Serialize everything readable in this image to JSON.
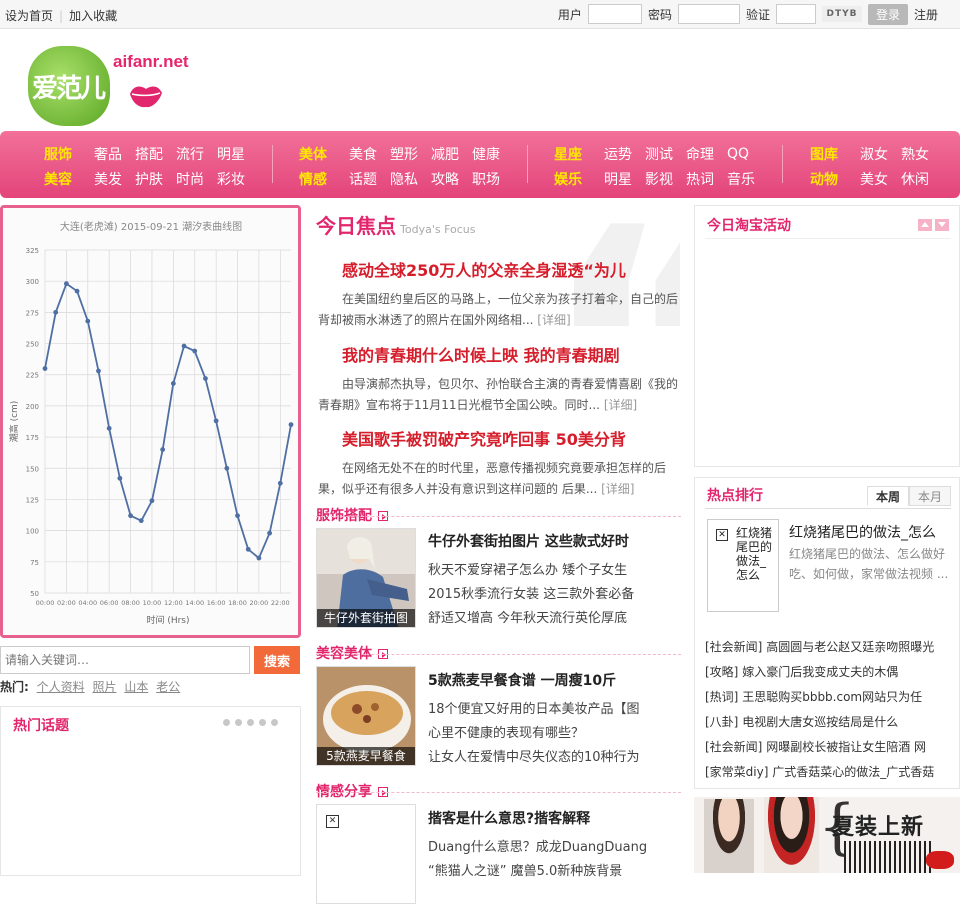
{
  "topbar": {
    "set_home": "设为首页",
    "bookmark": "加入收藏",
    "user_label": "用户",
    "password_label": "密码",
    "captcha_label": "验证",
    "captcha_text": "DTYB",
    "login_button": "登录",
    "register": "注册"
  },
  "logo": {
    "text": "爱范儿",
    "url": "aifanr.net"
  },
  "nav": {
    "groups": [
      {
        "heads": [
          "服饰",
          "美容"
        ],
        "rows": [
          [
            "奢品",
            "搭配",
            "流行",
            "明星"
          ],
          [
            "美发",
            "护肤",
            "时尚",
            "彩妆"
          ]
        ]
      },
      {
        "heads": [
          "美体",
          "情感"
        ],
        "rows": [
          [
            "美食",
            "塑形",
            "减肥",
            "健康"
          ],
          [
            "话题",
            "隐私",
            "攻略",
            "职场"
          ]
        ]
      },
      {
        "heads": [
          "星座",
          "娱乐"
        ],
        "rows": [
          [
            "运势",
            "测试",
            "命理",
            "QQ"
          ],
          [
            "明星",
            "影视",
            "热词",
            "音乐"
          ]
        ]
      },
      {
        "heads": [
          "图库",
          "动物"
        ],
        "rows": [
          [
            "淑女",
            "熟女"
          ],
          [
            "美女",
            "休闲"
          ]
        ]
      }
    ]
  },
  "chart_data": {
    "type": "line",
    "title": "大连(老虎滩) 2015-09-21 潮汐表曲线图",
    "xlabel": "时间 (Hrs)",
    "ylabel": "潮高 (cm)",
    "x": [
      "00:00",
      "01:00",
      "02:00",
      "03:00",
      "04:00",
      "05:00",
      "06:00",
      "07:00",
      "08:00",
      "09:00",
      "10:00",
      "11:00",
      "12:00",
      "13:00",
      "14:00",
      "15:00",
      "16:00",
      "17:00",
      "18:00",
      "19:00",
      "20:00",
      "21:00",
      "22:00",
      "23:00"
    ],
    "x_ticks": [
      "00:00",
      "02:00",
      "04:00",
      "06:00",
      "08:00",
      "10:00",
      "12:00",
      "14:00",
      "16:00",
      "18:00",
      "20:00",
      "22:00"
    ],
    "y": [
      230,
      275,
      298,
      292,
      268,
      228,
      182,
      142,
      112,
      108,
      124,
      165,
      218,
      248,
      244,
      222,
      188,
      150,
      112,
      85,
      78,
      98,
      138,
      185
    ],
    "ylim": [
      50,
      325
    ],
    "y_ticks": [
      50,
      75,
      100,
      125,
      150,
      175,
      200,
      225,
      250,
      275,
      300,
      325
    ],
    "grid": true,
    "color": "#4f6fa3"
  },
  "search": {
    "placeholder": "请输入关键词…",
    "button": "搜索",
    "hot_label": "热门:",
    "hot_tags": [
      "个人资料",
      "照片",
      "山本",
      "老公"
    ]
  },
  "topics": {
    "title": "热门话题"
  },
  "focus": {
    "title": "今日焦点",
    "subtitle": "Todya's Focus",
    "items": [
      {
        "title": "感动全球250万人的父亲全身湿透“为儿",
        "desc": "在美国纽约皇后区的马路上，一位父亲为孩子打着伞，自己的后背却被雨水淋透了的照片在国外网络相...",
        "more": "[详细]"
      },
      {
        "title": "我的青春期什么时候上映  我的青春期剧",
        "desc": "由导演郝杰执导，包贝尔、孙怡联合主演的青春爱情喜剧《我的青春期》宣布将于11月11日光棍节全国公映。同时...",
        "more": "[详细]"
      },
      {
        "title": "美国歌手被罚破产究竟咋回事  50美分背",
        "desc": "在网络无处不在的时代里，恶意传播视频究竟要承担怎样的后果，似乎还有很多人并没有意识到这样问题的 后果...",
        "more": "[详细]"
      }
    ]
  },
  "sections": [
    {
      "title": "服饰搭配",
      "thumb_caption": "牛仔外套街拍图",
      "headline": "牛仔外套街拍图片  这些款式好时",
      "items": [
        "秋天不爱穿裙子怎么办  矮个子女生",
        "2015秋季流行女装  这三款外套必备",
        "舒适又增高  今年秋天流行英伦厚底"
      ]
    },
    {
      "title": "美容美体",
      "thumb_caption": "5款燕麦早餐食",
      "headline": "5款燕麦早餐食谱  一周瘦10斤",
      "items": [
        "18个便宜又好用的日本美妆产品【图",
        "心里不健康的表现有哪些？",
        "让女人在爱情中尽失仪态的10种行为"
      ]
    },
    {
      "title": "情感分享",
      "thumb_caption": "",
      "headline": "揩客是什么意思?揩客解释",
      "items": [
        "Duang什么意思？成龙DuangDuang",
        "“熊猫人之谜” 魔兽5.0新种族背景"
      ]
    }
  ],
  "taobao": {
    "title": "今日淘宝活动"
  },
  "ranking": {
    "title": "热点排行",
    "tab_week": "本周",
    "tab_month": "本月",
    "feature_img_alt": "红烧猪尾巴的做法_怎么",
    "feature_title": "红烧猪尾巴的做法_怎么",
    "feature_desc": "红烧猪尾巴的做法、怎么做好吃、如何做，家常做法视频 ...",
    "list": [
      {
        "tag": "[社会新闻]",
        "text": "高圆圆与老公赵又廷亲吻照曝光"
      },
      {
        "tag": "[攻略]",
        "text": "嫁入豪门后我变成丈夫的木偶"
      },
      {
        "tag": "[热词]",
        "text": "王思聪购买bbbb.com网站只为任"
      },
      {
        "tag": "[八卦]",
        "text": "电视剧大唐女巡按结局是什么"
      },
      {
        "tag": "[社会新闻]",
        "text": "网曝副校长被指让女生陪酒  网"
      },
      {
        "tag": "[家常菜diy]",
        "text": "广式香菇菜心的做法_广式香菇"
      }
    ]
  },
  "ad": {
    "text": "夏装上新"
  }
}
